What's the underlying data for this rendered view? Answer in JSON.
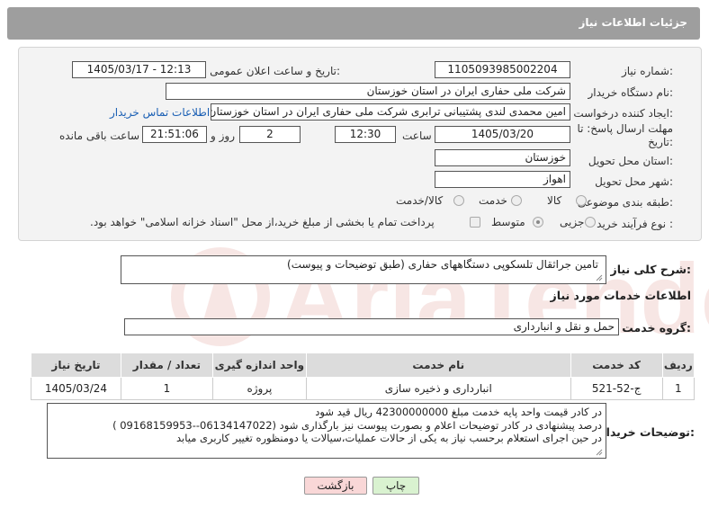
{
  "header": {
    "title": "جزئیات اطلاعات نیاز"
  },
  "fields": {
    "need_number_label": "شماره نیاز:",
    "need_number": "1105093985002204",
    "announce_label": "تاریخ و ساعت اعلان عمومی:",
    "announce_value": "1405/03/17 - 12:13",
    "buyer_org_label": "نام دستگاه خریدار:",
    "buyer_org": "شرکت ملی حفاری ایران در استان خوزستان",
    "creator_label": "ایجاد کننده درخواست:",
    "creator": "امین محمدی لندی پشتیبانی ترابری شرکت ملی حفاری ایران در استان خوزستان",
    "buyer_contact_link": "اطلاعات تماس خریدار",
    "deadline_label_1": "مهلت ارسال پاسخ: تا",
    "deadline_label_2": "تاریخ:",
    "deadline_date": "1405/03/20",
    "time_label": "ساعت",
    "deadline_time": "12:30",
    "days_value": "2",
    "days_label": "روز و",
    "remaining_time": "21:51:06",
    "remaining_label": "ساعت باقی مانده",
    "province_label": "استان محل تحویل:",
    "province": "خوزستان",
    "city_label": "شهر محل تحویل:",
    "city": "اهواز",
    "category_label": "طبقه بندی موضوعی:",
    "category_options": [
      "کالا",
      "خدمت",
      "کالا/خدمت"
    ],
    "purchase_type_label": "نوع فرآیند خرید :",
    "purchase_options": [
      "جزیی",
      "متوسط"
    ],
    "payment_note": "پرداخت تمام یا بخشی از مبلغ خرید،از محل \"اسناد خزانه اسلامی\" خواهد بود."
  },
  "description": {
    "label": "شرح کلی نیاز:",
    "value": "تامین جراثقال تلسکوپی دستگاههای حفاری (طبق توضیحات و پیوست)"
  },
  "services": {
    "title": "اطلاعات خدمات مورد نیاز",
    "group_label": "گروه خدمت:",
    "group_value": "حمل و نقل و انبارداری",
    "columns": [
      "ردیف",
      "کد خدمت",
      "نام خدمت",
      "واحد اندازه گیری",
      "تعداد / مقدار",
      "تاریخ نیاز"
    ],
    "rows": [
      {
        "row": "1",
        "code": "ج-52-521",
        "name": "انبارداری و ذخیره سازی",
        "unit": "پروژه",
        "qty": "1",
        "date": "1405/03/24"
      }
    ]
  },
  "buyer_notes": {
    "label": "توضیحات خریدار:",
    "lines": [
      "در کادر قیمت واحد پایه خدمت مبلغ 42300000000 ریال قید شود",
      "درصد پیشنهادی در کادر توضیحات اعلام و بصورت پیوست نیز بارگذاری شود (06134147022--09168159953 )",
      "در حین اجرای استعلام  برحسب نیاز به یکی از حالات عملیات،سیالات یا دومنظوره تغییر کاربری میابد"
    ]
  },
  "buttons": {
    "print": "چاپ",
    "back": "بازگشت"
  },
  "colors": {
    "header_bg": "#9e9e9e",
    "back_button_bg": "#f9d7d7",
    "print_button_bg": "#d9f2d0",
    "link": "#1a5fb4"
  }
}
